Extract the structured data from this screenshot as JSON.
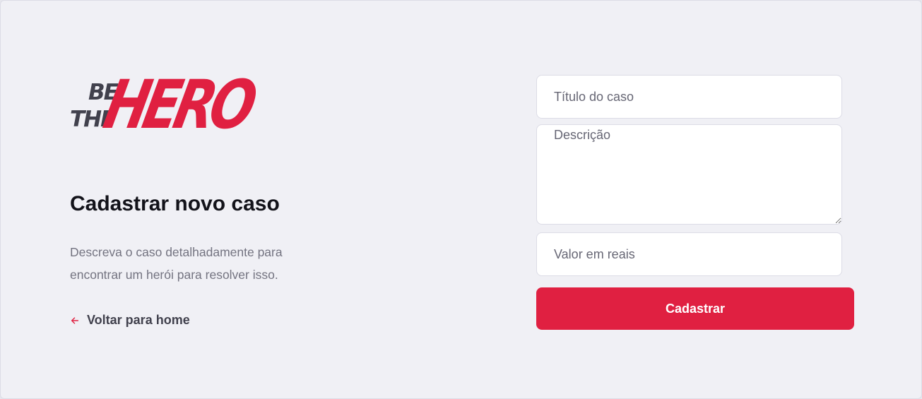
{
  "logo": {
    "alt": "Be The Hero",
    "be": "BE",
    "the": "THE",
    "hero": "HERO"
  },
  "heading": "Cadastrar novo caso",
  "description": "Descreva o caso detalhadamente para encontrar um herói para resolver isso.",
  "back_link": {
    "label": "Voltar para home",
    "icon": "arrow-left-icon"
  },
  "form": {
    "title_placeholder": "Título do caso",
    "title_value": "",
    "description_placeholder": "Descrição",
    "description_value": "",
    "value_placeholder": "Valor em reais",
    "value_value": "",
    "submit_label": "Cadastrar"
  },
  "colors": {
    "brand": "#e02041",
    "background": "#f0f0f5",
    "dark_text": "#41414d",
    "muted_text": "#737380"
  }
}
